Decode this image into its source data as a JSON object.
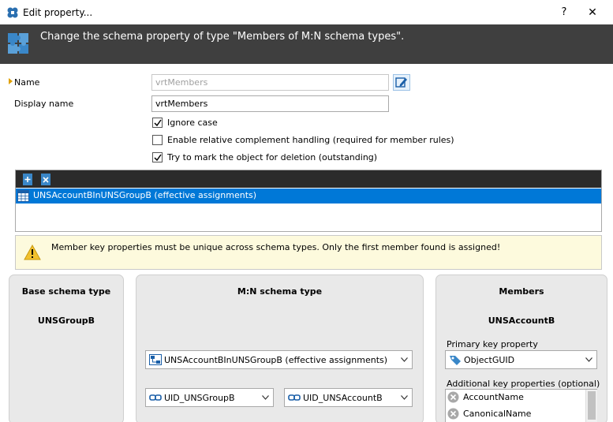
{
  "window": {
    "title": "Edit property...",
    "help_label": "?",
    "close_label": "✕"
  },
  "banner": {
    "text": "Change the schema property of type \"Members of M:N schema types\"."
  },
  "form": {
    "name_label": "Name",
    "name_value": "vrtMembers",
    "display_name_label": "Display name",
    "display_name_value": "vrtMembers",
    "checkboxes": [
      {
        "label": "Ignore case",
        "checked": true
      },
      {
        "label": "Enable relative complement handling (required for member rules)",
        "checked": false
      },
      {
        "label": "Try to mark the object for deletion (outstanding)",
        "checked": true
      }
    ]
  },
  "member_list": {
    "items": [
      {
        "label": "UNSAccountBInUNSGroupB (effective assignments)",
        "selected": true
      }
    ]
  },
  "warning": {
    "text": "Member key properties must be unique across schema types. Only the first member found is assigned!"
  },
  "base_card": {
    "title": "Base schema type",
    "value": "UNSGroupB"
  },
  "mn_card": {
    "title": "M:N schema type",
    "schema_type": "UNSAccountBInUNSGroupB (effective assignments)",
    "left_key": "UID_UNSGroupB",
    "right_key": "UID_UNSAccountB"
  },
  "members_card": {
    "title": "Members",
    "value": "UNSAccountB",
    "primary_key_label": "Primary key property",
    "primary_key_value": "ObjectGUID",
    "additional_keys_label": "Additional key properties (optional)",
    "additional_keys": [
      "AccountName",
      "CanonicalName"
    ]
  },
  "colors": {
    "banner_bg": "#3f3f3f",
    "selection": "#0078d7",
    "warning_bg": "#fdfadd",
    "card_bg": "#e9e9e9"
  }
}
